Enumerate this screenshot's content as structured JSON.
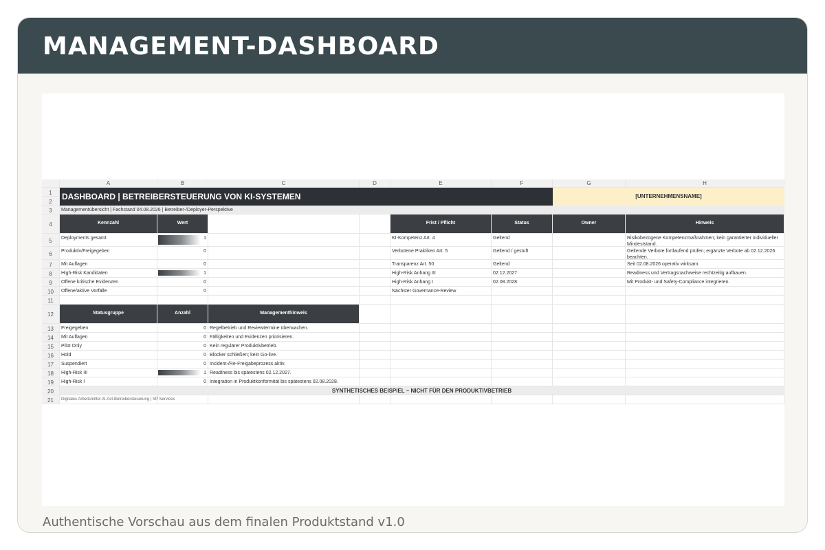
{
  "header": {
    "title": "MANAGEMENT-DASHBOARD"
  },
  "caption": "Authentische Vorschau aus dem finalen Produktstand v1.0",
  "colors": {
    "header_bg": "#3a4a4f",
    "dark_cell": "#3b3f43",
    "banner": "#2d3034",
    "company_bg": "#fdf0c8"
  },
  "sheet": {
    "columns": [
      "A",
      "B",
      "C",
      "D",
      "E",
      "F",
      "G",
      "H"
    ],
    "row_numbers": [
      "1",
      "2",
      "3",
      "4",
      "5",
      "6",
      "7",
      "8",
      "9",
      "10",
      "11",
      "12",
      "13",
      "14",
      "15",
      "16",
      "17",
      "18",
      "19",
      "20",
      "21"
    ],
    "banner_title": "DASHBOARD | BETREIBERSTEUERUNG VON KI-SYSTEMEN",
    "company_placeholder": "[UNTERNEHMENSNAME]",
    "subtitle": "Managementübersicht | Fachstand 04.08.2026 | Betreiber-/Deployer-Perspektive",
    "kpi_headers": [
      "Kennzahl",
      "Wert"
    ],
    "kpis": [
      {
        "label": "Deployments gesamt",
        "value": "1",
        "bar": 1
      },
      {
        "label": "Produktiv/Freigegeben",
        "value": "0",
        "bar": 0
      },
      {
        "label": "Mit Auflagen",
        "value": "0",
        "bar": 0
      },
      {
        "label": "High-Risk Kandidaten",
        "value": "1",
        "bar": 1
      },
      {
        "label": "Offene kritische Evidenzen",
        "value": "0",
        "bar": 0
      },
      {
        "label": "Offene/aktive Vorfälle",
        "value": "0",
        "bar": 0
      }
    ],
    "deadline_headers": [
      "Frist / Pflicht",
      "Status",
      "Owner",
      "Hinweis"
    ],
    "deadlines": [
      {
        "duty": "KI-Kompetenz Art. 4",
        "status": "Geltend",
        "owner": "",
        "note": "Risikobezogene Kompetenzmaßnahmen; kein garantierter individueller Mindeststand."
      },
      {
        "duty": "Verbotene Praktiken Art. 5",
        "status": "Geltend / gestuft",
        "owner": "",
        "note": "Geltende Verbote fortlaufend prüfen; ergänzte Verbote ab 02.12.2026 beachten."
      },
      {
        "duty": "Transparenz Art. 50",
        "status": "Geltend",
        "owner": "",
        "note": "Seit 02.08.2026 operativ wirksam."
      },
      {
        "duty": "High-Risk Anhang III",
        "status": "02.12.2027",
        "owner": "",
        "note": "Readiness und Vertragsnachweise rechtzeitig aufbauen."
      },
      {
        "duty": "High-Risk Anhang I",
        "status": "02.08.2028",
        "owner": "",
        "note": "Mit Produkt- und Safety-Compliance integrieren."
      },
      {
        "duty": "Nächster Governance-Review",
        "status": "",
        "owner": "",
        "note": ""
      }
    ],
    "status_headers": [
      "Statusgruppe",
      "Anzahl",
      "Managementhinweis"
    ],
    "status_groups": [
      {
        "group": "Freigegeben",
        "count": "0",
        "bar": 0,
        "hint": "Regelbetrieb und Reviewtermine überwachen."
      },
      {
        "group": "Mit Auflagen",
        "count": "0",
        "bar": 0,
        "hint": "Fälligkeiten und Evidenzen priorisieren."
      },
      {
        "group": "Pilot Only",
        "count": "0",
        "bar": 0,
        "hint": "Kein regulärer Produktivbetrieb."
      },
      {
        "group": "Hold",
        "count": "0",
        "bar": 0,
        "hint": "Blocker schließen; kein Go-live."
      },
      {
        "group": "Suspendiert",
        "count": "0",
        "bar": 0,
        "hint": "Incident-/Re-Freigabeprozess aktiv."
      },
      {
        "group": "High-Risk III",
        "count": "1",
        "bar": 1,
        "hint": "Readiness bis spätestens 02.12.2027."
      },
      {
        "group": "High-Risk I",
        "count": "0",
        "bar": 0,
        "hint": "Integration in Produktkonformität bis spätestens 02.08.2028."
      }
    ],
    "disclaimer": "SYNTHETISCHES BEISPIEL – NICHT FÜR DEN PRODUKTIVBETRIEB",
    "footer": "Digitales Arbeitsmittel AI-Act-Betreibersteuerung | SP Services"
  }
}
